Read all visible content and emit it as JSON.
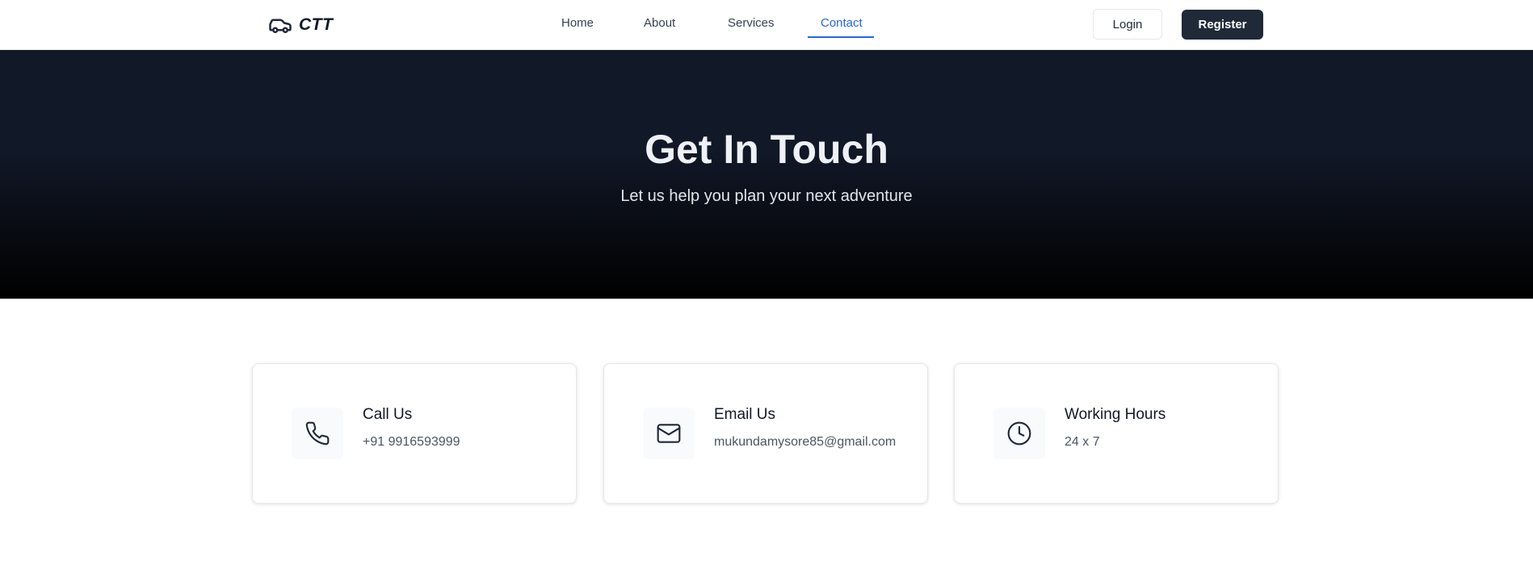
{
  "brand": {
    "name": "CTT",
    "logo_icon": "car-icon"
  },
  "nav": {
    "items": [
      {
        "label": "Home"
      },
      {
        "label": "About"
      },
      {
        "label": "Services"
      },
      {
        "label": "Contact",
        "active": true
      }
    ]
  },
  "auth": {
    "login_label": "Login",
    "register_label": "Register"
  },
  "hero": {
    "title": "Get In Touch",
    "subtitle": "Let us help you plan your next adventure"
  },
  "contact_cards": [
    {
      "icon": "phone-icon",
      "title": "Call Us",
      "value": "+91 9916593999"
    },
    {
      "icon": "mail-icon",
      "title": "Email Us",
      "value": "mukundamysore85@gmail.com"
    },
    {
      "icon": "clock-icon",
      "title": "Working Hours",
      "value": "24 x 7"
    }
  ],
  "colors": {
    "accent": "#2563eb",
    "primary_button": "#1f2937",
    "hero_top": "#111827",
    "hero_bottom": "#000000"
  }
}
